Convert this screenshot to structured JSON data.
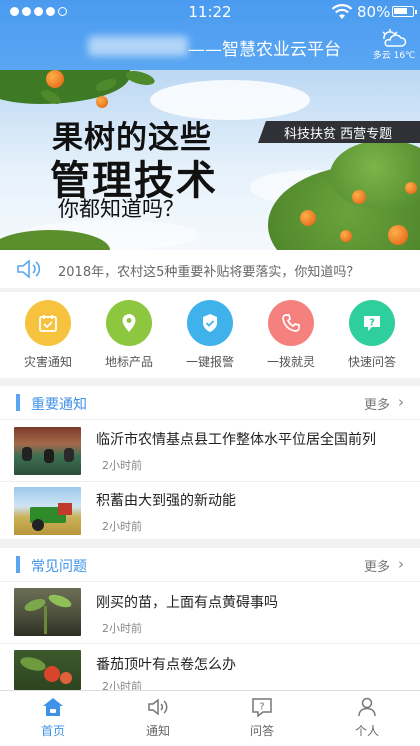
{
  "status_bar": {
    "time": "11:22",
    "battery": "80%",
    "battery_level": 0.8
  },
  "header": {
    "app_title": "——智慧农业云平台",
    "weather": "多云 16℃"
  },
  "banner": {
    "line1": "果树的这些",
    "line2": "管理技术",
    "line3": "你都知道吗？",
    "tag": "科技扶贫  西营专题"
  },
  "announcement": {
    "text": "2018年，农村这5种重要补贴将要落实，你知道吗？"
  },
  "quick_actions": [
    {
      "label": "灾害通知",
      "icon": "calendar-check-icon",
      "color": "#f7c23e"
    },
    {
      "label": "地标产品",
      "icon": "location-pin-icon",
      "color": "#8dc63f"
    },
    {
      "label": "一键报警",
      "icon": "shield-check-icon",
      "color": "#3fb2ec"
    },
    {
      "label": "一拨就灵",
      "icon": "phone-icon",
      "color": "#f5817e"
    },
    {
      "label": "快速问答",
      "icon": "chat-question-icon",
      "color": "#2fcf9d"
    }
  ],
  "notices": {
    "title": "重要通知",
    "more": "更多",
    "items": [
      {
        "title": "临沂市农情基点县工作整体水平位居全国前列",
        "time": "2小时前"
      },
      {
        "title": "积蓄由大到强的新动能",
        "time": "2小时前"
      }
    ]
  },
  "faq": {
    "title": "常见问题",
    "more": "更多",
    "items": [
      {
        "title": "刚买的苗，上面有点黄碍事吗",
        "time": "2小时前"
      },
      {
        "title": "番茄顶叶有点卷怎么办",
        "time": "2小时前"
      }
    ]
  },
  "tabbar": [
    {
      "label": "首页",
      "icon": "home-icon",
      "active": true
    },
    {
      "label": "通知",
      "icon": "speaker-icon",
      "active": false
    },
    {
      "label": "问答",
      "icon": "question-icon",
      "active": false
    },
    {
      "label": "个人",
      "icon": "person-icon",
      "active": false
    }
  ]
}
